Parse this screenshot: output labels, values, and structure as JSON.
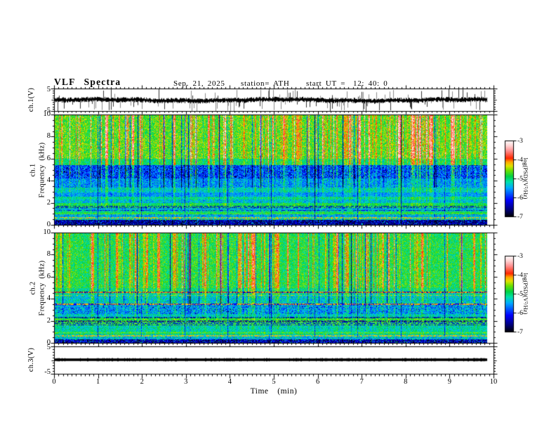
{
  "header": {
    "title": "VLF Spectra",
    "date": "Sep. 21, 2025",
    "station": "station= ATH",
    "start_ut": "start UT =  12: 40: 0"
  },
  "axes": {
    "time_label": "Time  (min)",
    "x_ticks": [
      "0",
      "1",
      "2",
      "3",
      "4",
      "5",
      "6",
      "7",
      "8",
      "9",
      "10"
    ],
    "freq_ticks": [
      "10",
      "8",
      "6",
      "4",
      "2",
      "0"
    ],
    "volt_ticks": [
      "5",
      "-5"
    ],
    "colorbar_ticks": [
      "-3",
      "-4",
      "-5",
      "-6",
      "-7"
    ],
    "colorbar_label": "log(PSD)(V²/Hz)"
  },
  "panels": {
    "ch1_wave": {
      "ylabel": "ch.1(V)",
      "ylim": [
        -5,
        5
      ]
    },
    "ch1_spec": {
      "ylabel_line1": "ch.1",
      "ylabel_line2": "Frequency  (kHz)",
      "ylim": [
        0,
        10
      ]
    },
    "ch2_spec": {
      "ylabel_line1": "ch.2",
      "ylabel_line2": "Frequency  (kHz)",
      "ylim": [
        0,
        10
      ]
    },
    "ch3_wave": {
      "ylabel": "ch.3(V)",
      "ylim": [
        -5,
        5
      ]
    }
  },
  "colors": {
    "foreground": "#000000",
    "background": "#ffffff",
    "colormap_order_bottom_to_top": [
      "black",
      "dark blue",
      "blue",
      "cyan",
      "green",
      "yellow",
      "orange",
      "red",
      "pink",
      "white"
    ]
  },
  "chart_data": [
    {
      "type": "line",
      "panel": "ch.1 (V) waveform",
      "xlim_min": [
        0,
        10
      ],
      "x_end_min": 9.85,
      "ylim_V": [
        -5,
        5
      ],
      "description": "Broadband noise trace centered near 0 V, dense band about ±1 V, frequent impulsive spikes reaching ±5 V"
    },
    {
      "type": "heatmap",
      "panel": "ch.1 spectrogram",
      "xlim_min": [
        0,
        10
      ],
      "x_end_min": 9.85,
      "ylim_kHz": [
        0,
        10
      ],
      "colorbar": {
        "label": "log(PSD)(V²/Hz)",
        "min": -7,
        "max": -3
      },
      "bands": [
        {
          "f": [
            6,
            10
          ],
          "L": -4.78,
          "A": 0.42,
          "S": 1.1,
          "note": "yellow-green base with dense red vertical bursts"
        },
        {
          "f": [
            5.4,
            6
          ],
          "L": -5.05,
          "A": 0.38,
          "S": 0.9
        },
        {
          "f": [
            4.2,
            5.4
          ],
          "L": -5.95,
          "A": 0.5,
          "S": 0.85,
          "pk": 0.1,
          "pv": -0.9,
          "note": "dark blue band with black dashes"
        },
        {
          "f": [
            3.4,
            4.2
          ],
          "L": -5.62,
          "A": 0.45,
          "S": 0.5,
          "note": "cyan-blue mottle"
        },
        {
          "f": [
            2.9,
            3.4
          ],
          "L": -5.3,
          "A": 0.38,
          "S": 0.4
        },
        {
          "f": [
            2.55,
            2.9
          ],
          "L": -5.6,
          "A": 0.35,
          "S": 0.35
        },
        {
          "f": [
            2.3,
            2.55
          ],
          "L": -5.15,
          "A": 0.3,
          "S": 0.3
        },
        {
          "f": [
            1.95,
            2.3
          ],
          "L": -5.4,
          "A": 0.42,
          "S": 0.3
        },
        {
          "f": [
            1.75,
            1.95
          ],
          "L": -4.95,
          "A": 0.3,
          "S": 0.25
        },
        {
          "f": [
            1.45,
            1.75
          ],
          "L": -5.5,
          "A": 0.5,
          "S": 0.2
        },
        {
          "f": [
            1.2,
            1.45
          ],
          "L": -5.45,
          "A": 0.4,
          "S": 0.2
        },
        {
          "f": [
            0.95,
            1.2
          ],
          "L": -4.95,
          "A": 0.3,
          "S": 0.15,
          "note": "green-yellow band"
        },
        {
          "f": [
            0.7,
            0.95
          ],
          "L": -5.45,
          "A": 0.5,
          "S": 0.1
        },
        {
          "f": [
            0.45,
            0.7
          ],
          "L": -5.15,
          "A": 0.7,
          "S": 0.1
        },
        {
          "f": [
            0,
            0.45
          ],
          "L": -6.55,
          "A": 0.45,
          "S": 0,
          "pk": 0.12,
          "pv": 1.0,
          "note": "near-black with cyan speckle"
        }
      ],
      "lines": [
        {
          "f": 1.68,
          "p": 0.5,
          "hi": -4.7,
          "lo": -6.6,
          "note": "dark streak"
        },
        {
          "f": 1.55,
          "p": 0.5,
          "hi": -4.7,
          "lo": -6.6,
          "note": "dark streak"
        },
        {
          "f": 1.3,
          "p": 0.5,
          "hi": -5.0,
          "lo": -6.3
        },
        {
          "f": 1.0,
          "p": 0.7,
          "hi": -4.55,
          "lo": -5.0,
          "note": "yellow line"
        },
        {
          "f": 0.62,
          "p": 0.55,
          "hi": -4.2,
          "lo": -5.3,
          "note": "orange dashed line"
        }
      ],
      "features": [
        "red impulsive streaks 4-10 kHz",
        "dark blue band 4.2-5.4 kHz",
        "faint dark column each integer minute"
      ]
    },
    {
      "type": "heatmap",
      "panel": "ch.2 spectrogram",
      "xlim_min": [
        0,
        10
      ],
      "x_end_min": 9.85,
      "ylim_kHz": [
        0,
        10
      ],
      "colorbar": {
        "label": "log(PSD)(V²/Hz)",
        "min": -7,
        "max": -3
      },
      "bands": [
        {
          "f": [
            5.0,
            10
          ],
          "L": -4.95,
          "A": 0.4,
          "S": 1.0,
          "note": "green base with red vertical bursts"
        },
        {
          "f": [
            4.65,
            5.0
          ],
          "L": -5.1,
          "A": 0.4,
          "S": 0.7
        },
        {
          "f": [
            4.2,
            4.65
          ],
          "L": -5.2,
          "A": 0.4,
          "S": 0.6
        },
        {
          "f": [
            3.55,
            4.2
          ],
          "L": -5.35,
          "A": 0.45,
          "S": 0.5
        },
        {
          "f": [
            2.6,
            3.55
          ],
          "L": -5.55,
          "A": 0.5,
          "S": 0.45,
          "pk": 0.08,
          "pv": -0.8,
          "note": "cyan-blue mottle"
        },
        {
          "f": [
            2.3,
            2.6
          ],
          "L": -5.3,
          "A": 0.4,
          "S": 0.3
        },
        {
          "f": [
            2.05,
            2.3
          ],
          "L": -4.8,
          "A": 0.3,
          "S": 0.25,
          "note": "yellow band"
        },
        {
          "f": [
            1.5,
            2.05
          ],
          "L": -5.25,
          "A": 0.4,
          "S": 0.2
        },
        {
          "f": [
            1.0,
            1.5
          ],
          "L": -5.2,
          "A": 0.38,
          "S": 0.2
        },
        {
          "f": [
            0.75,
            1.0
          ],
          "L": -4.95,
          "A": 0.35,
          "S": 0.15
        },
        {
          "f": [
            0.55,
            0.75
          ],
          "L": -5.3,
          "A": 0.45,
          "S": 0.1
        },
        {
          "f": [
            0.3,
            0.55
          ],
          "L": -5.35,
          "A": 0.5,
          "S": 0.1
        },
        {
          "f": [
            0,
            0.3
          ],
          "L": -6.45,
          "A": 0.6,
          "S": 0,
          "pk": 0.12,
          "pv": 1.1,
          "note": "near-black speckle"
        }
      ],
      "lines": [
        {
          "f": 4.6,
          "p": 0.55,
          "hi": -4.1,
          "lo": -6.4,
          "note": "red/dark horizontal line"
        },
        {
          "f": 4.3,
          "p": 0.4,
          "hi": -4.3,
          "lo": -5.4
        },
        {
          "f": 3.5,
          "p": 0.6,
          "hi": -4.15,
          "lo": -6.2,
          "note": "red horizontal line"
        },
        {
          "f": 2.28,
          "p": 0.5,
          "hi": -5.0,
          "lo": -6.4
        },
        {
          "f": 2.02,
          "p": 0.5,
          "hi": -5.0,
          "lo": -6.4
        },
        {
          "f": 1.9,
          "p": 0.5,
          "hi": -4.6,
          "lo": -6.5
        },
        {
          "f": 1.75,
          "p": 0.5,
          "hi": -4.6,
          "lo": -6.5
        },
        {
          "f": 1.62,
          "p": 0.5,
          "hi": -4.6,
          "lo": -6.5
        },
        {
          "f": 0.92,
          "p": 0.6,
          "hi": -4.5,
          "lo": -5.2,
          "note": "yellow line"
        },
        {
          "f": 0.65,
          "p": 0.6,
          "hi": -4.2,
          "lo": -5.3,
          "note": "orange line"
        }
      ],
      "features": [
        "red streaks reach lower frequencies than ch.1",
        "multiple dark horizontal lines 1.5-2.3 kHz"
      ]
    },
    {
      "type": "line",
      "panel": "ch.3 (V) waveform",
      "xlim_min": [
        0,
        10
      ],
      "x_end_min": 9.85,
      "ylim_V": [
        -5,
        5
      ],
      "value_V": 0,
      "description": "Thick flat black trace at 0 V (no signal on channel 3)"
    }
  ]
}
